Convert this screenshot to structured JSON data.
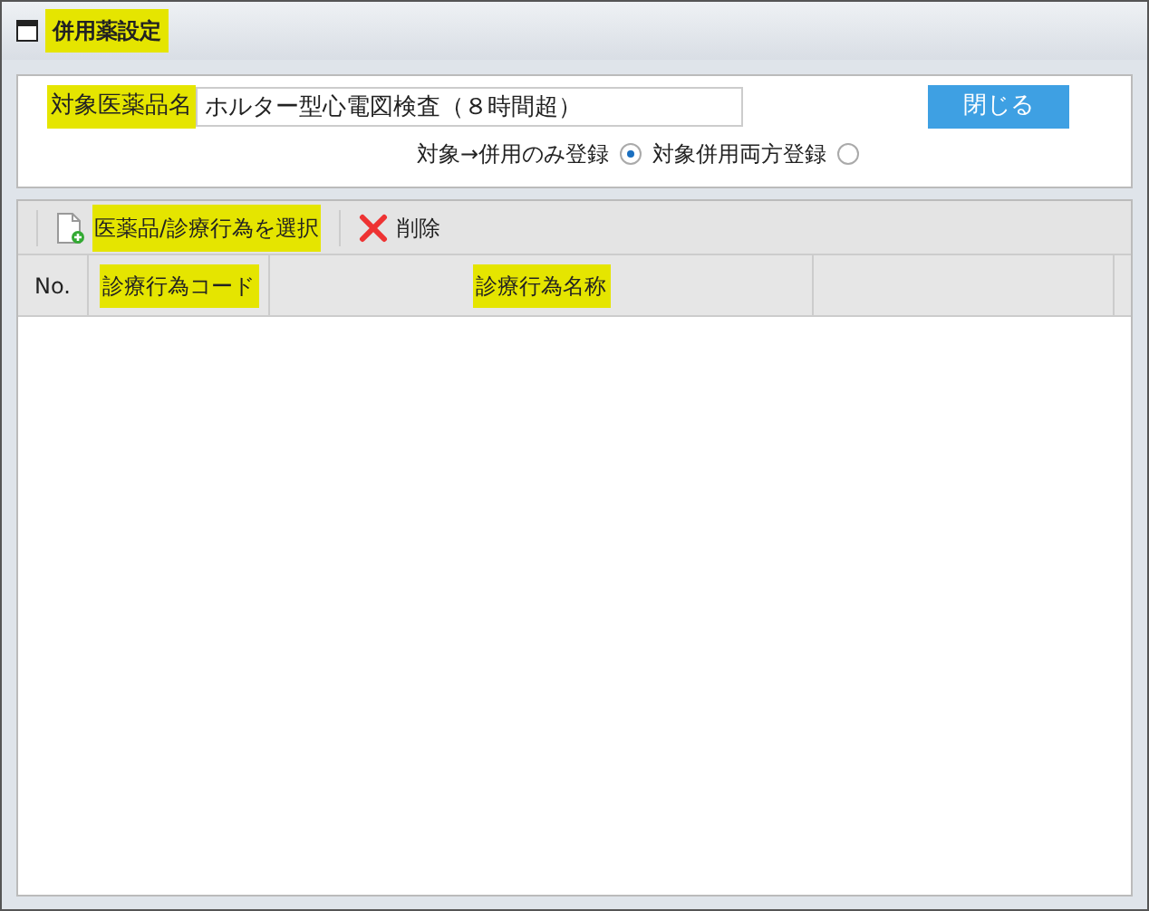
{
  "window": {
    "title": "併用薬設定",
    "highlighted": true
  },
  "form": {
    "label": "対象医薬品名",
    "label_highlighted": true,
    "value": "ホルター型心電図検査（８時間超）",
    "close_button": "閉じる",
    "radios": [
      {
        "label": "対象→併用のみ登録",
        "selected": true
      },
      {
        "label": "対象併用両方登録",
        "selected": false
      }
    ]
  },
  "toolbar": [
    {
      "kind": "add",
      "label": "医薬品/診療行為を選択",
      "highlighted": true
    },
    {
      "kind": "delete",
      "label": "削除",
      "highlighted": false
    }
  ],
  "table": {
    "columns": [
      {
        "label": "No.",
        "highlighted": false
      },
      {
        "label": "診療行為コード",
        "highlighted": true
      },
      {
        "label": "診療行為名称",
        "highlighted": true
      }
    ]
  }
}
